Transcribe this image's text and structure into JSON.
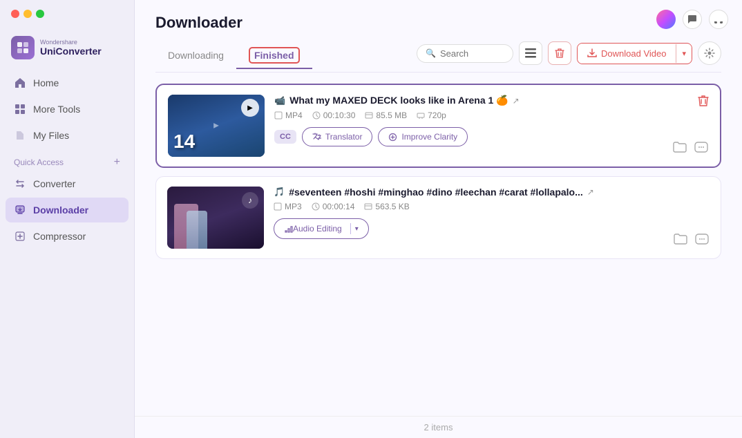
{
  "app": {
    "name": "UniConverter",
    "brand": "Wondershare"
  },
  "traffic_lights": {
    "red": "#ff5f57",
    "yellow": "#ffbd2e",
    "green": "#28c840"
  },
  "sidebar": {
    "items": [
      {
        "id": "home",
        "label": "Home",
        "icon": "home"
      },
      {
        "id": "more-tools",
        "label": "More Tools",
        "icon": "grid"
      },
      {
        "id": "my-files",
        "label": "My Files",
        "icon": "files"
      }
    ],
    "section_label": "Quick Access",
    "section_items": [
      {
        "id": "converter",
        "label": "Converter",
        "icon": "converter"
      },
      {
        "id": "downloader",
        "label": "Downloader",
        "icon": "downloader",
        "active": true
      },
      {
        "id": "compressor",
        "label": "Compressor",
        "icon": "compressor"
      }
    ]
  },
  "page": {
    "title": "Downloader",
    "tabs": [
      {
        "id": "downloading",
        "label": "Downloading",
        "active": false
      },
      {
        "id": "finished",
        "label": "Finished",
        "active": true
      }
    ]
  },
  "toolbar": {
    "search_placeholder": "Search",
    "download_video_label": "Download Video"
  },
  "items": [
    {
      "id": "video1",
      "type": "video",
      "title": "What my MAXED DECK looks like in Arena 1 🍊",
      "format": "MP4",
      "duration": "00:10:30",
      "size": "85.5 MB",
      "quality": "720p",
      "actions": [
        "CC",
        "Translator",
        "Improve Clarity"
      ]
    },
    {
      "id": "audio1",
      "type": "audio",
      "title": "#seventeen #hoshi #minghao #dino #leechan #carat #lollapalo...",
      "format": "MP3",
      "duration": "00:00:14",
      "size": "563.5 KB",
      "actions": [
        "Audio Editing"
      ]
    }
  ],
  "footer": {
    "item_count": "2 items"
  }
}
